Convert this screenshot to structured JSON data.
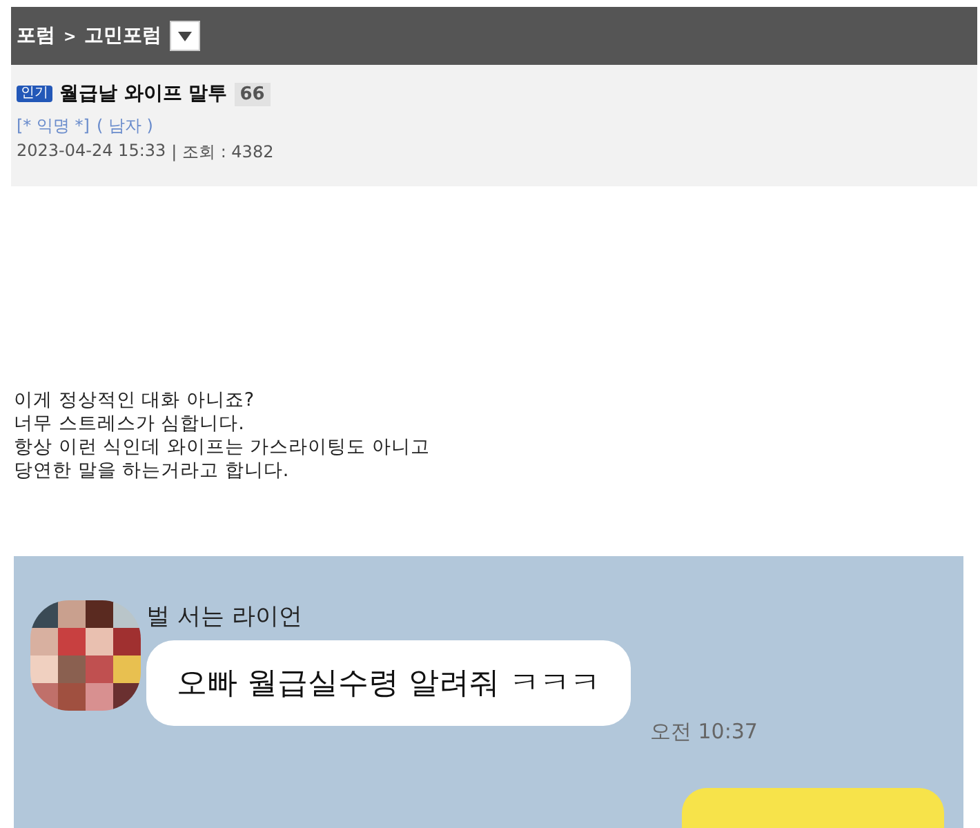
{
  "breadcrumb": {
    "forum": "포럼",
    "separator": ">",
    "board": "고민포럼"
  },
  "post": {
    "badge": "인기",
    "title": "월급날 와이프 말투",
    "comment_count": "66",
    "author": "[* 익명 *]",
    "gender": "( 남자 )",
    "date": "2023-04-24 15:33",
    "views_label": "| 조회 : 4382"
  },
  "body": [
    "이게 정상적인 대화 아니죠?",
    "너무 스트레스가 심합니다.",
    "항상 이런 식인데 와이프는 가스라이팅도 아니고",
    "당연한 말을 하는거라고 합니다."
  ],
  "chat": {
    "messages": [
      {
        "kind": "received",
        "sender": "벌 서는 라이언",
        "text": "오빠 월급실수령 알려줘 ㅋㅋㅋ",
        "time": "오전 10:37"
      },
      {
        "kind": "sent"
      }
    ]
  }
}
